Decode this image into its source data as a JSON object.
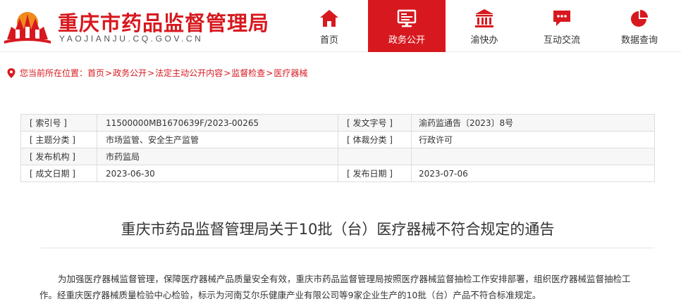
{
  "site": {
    "title": "重庆市药品监督管理局",
    "domain": "YAOJIANJU.CQ.GOV.CN",
    "brand_color": "#d7191f"
  },
  "nav": {
    "items": [
      {
        "label": "首页",
        "icon": "home-icon",
        "active": false
      },
      {
        "label": "政务公开",
        "icon": "monitor-icon",
        "active": true
      },
      {
        "label": "渝快办",
        "icon": "government-building-icon",
        "active": false
      },
      {
        "label": "互动交流",
        "icon": "chat-icon",
        "active": false
      },
      {
        "label": "数据查询",
        "icon": "pie-chart-icon",
        "active": false
      }
    ]
  },
  "breadcrumb": {
    "prefix": "您当前所在位置：",
    "items": [
      "首页",
      "政务公开",
      "法定主动公开内容",
      "监督检查",
      "医疗器械"
    ],
    "separator": ">"
  },
  "meta": {
    "rows": [
      [
        {
          "k": "[ 索引号 ]",
          "v": "11500000MB1670639F/2023-00265"
        },
        {
          "k": "[ 发文字号 ]",
          "v": "渝药监通告〔2023〕8号"
        }
      ],
      [
        {
          "k": "[ 主题分类 ]",
          "v": "市场监管、安全生产监管"
        },
        {
          "k": "[ 体裁分类 ]",
          "v": "行政许可"
        }
      ],
      [
        {
          "k": "[ 发布机构 ]",
          "v": "市药监局"
        },
        {
          "k": "",
          "v": ""
        }
      ],
      [
        {
          "k": "[ 成文日期 ]",
          "v": "2023-06-30"
        },
        {
          "k": "[ 发布日期 ]",
          "v": "2023-07-06"
        }
      ]
    ]
  },
  "document": {
    "title": "重庆市药品监督管理局关于10批（台）医疗器械不符合规定的通告",
    "paragraph": "为加强医疗器械监督管理，保障医疗器械产品质量安全有效，重庆市药品监督管理局按照医疗器械监督抽检工作安排部署，组织医疗器械监督抽检工作。经重庆医疗器械质量检验中心检验，标示为河南艾尔乐健康产业有限公司等9家企业生产的10批（台）产品不符合标准规定。"
  }
}
